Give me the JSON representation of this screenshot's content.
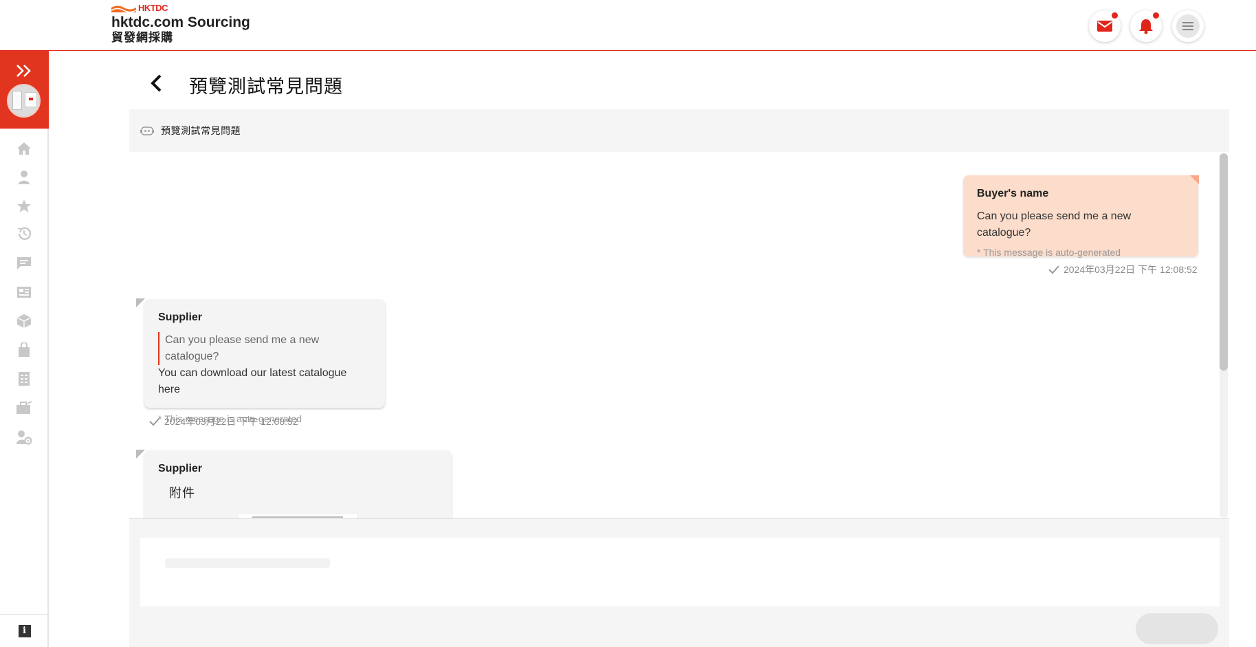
{
  "header": {
    "brand_mark": "HKTDC",
    "site_title": "hktdc.com Sourcing",
    "site_subtitle": "貿發網採購",
    "colors": {
      "accent": "#e1251b"
    },
    "icons": [
      "mail-icon",
      "bell-icon",
      "hamburger-menu-icon"
    ]
  },
  "sidebar": {
    "items": [
      {
        "icon": "home-icon"
      },
      {
        "icon": "user-icon"
      },
      {
        "icon": "star-icon"
      },
      {
        "icon": "history-icon"
      },
      {
        "icon": "chat-icon"
      },
      {
        "icon": "news-icon"
      },
      {
        "icon": "box-icon"
      },
      {
        "icon": "bag-icon"
      },
      {
        "icon": "list-icon"
      },
      {
        "icon": "briefcase-icon"
      },
      {
        "icon": "user-settings-icon"
      }
    ],
    "info_label": "i"
  },
  "page": {
    "title": "預覽測試常見問題"
  },
  "chat": {
    "header_name": "預覽測試常見問題",
    "messages": [
      {
        "sender": "Buyer's name",
        "text": "Can you please send me a new catalogue?",
        "note": "* This message is auto-generated",
        "time": "2024年03月22日 下午 12:08:52"
      },
      {
        "sender": "Supplier",
        "quote": "Can you please send me a new catalogue?",
        "text": "You can download our latest catalogue here",
        "note": "* This message is auto-generated",
        "time": "2024年03月22日 下午 12:08:52"
      },
      {
        "sender": "Supplier",
        "attachment_label": "附件"
      }
    ]
  }
}
